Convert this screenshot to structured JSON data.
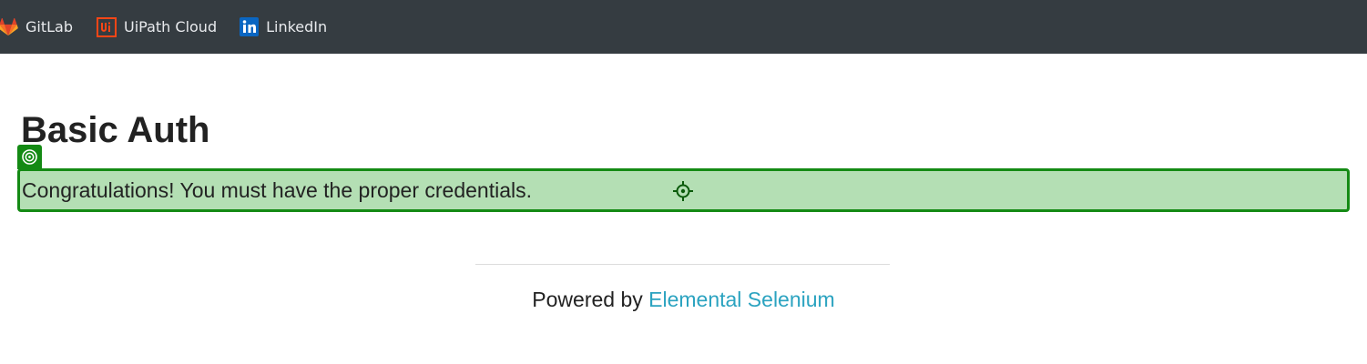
{
  "bookmarks": [
    {
      "label": "GitLab",
      "icon": "gitlab-icon"
    },
    {
      "label": "UiPath Cloud",
      "icon": "uipath-icon"
    },
    {
      "label": "LinkedIn",
      "icon": "linkedin-icon"
    }
  ],
  "page": {
    "title": "Basic Auth",
    "message": "Congratulations! You must have the proper credentials."
  },
  "footer": {
    "prefix": "Powered by ",
    "link_text": "Elemental Selenium"
  },
  "colors": {
    "bookmarks_bar_bg": "#353c41",
    "highlight_border": "#148a14",
    "highlight_fill": "#b4dfb4",
    "link": "#2ba3c0"
  },
  "icons": {
    "target_badge": "target-icon",
    "crosshair": "crosshair-icon"
  }
}
